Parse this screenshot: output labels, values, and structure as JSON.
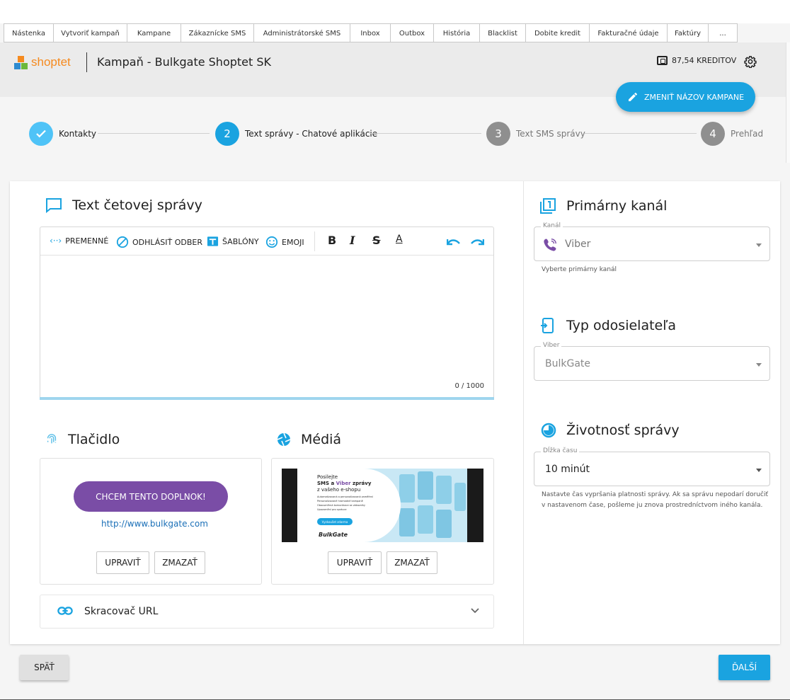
{
  "nav": {
    "tabs": [
      "Nástenka",
      "Vytvoriť kampaň",
      "Kampane",
      "Zákaznícke SMS",
      "Administrátorské SMS",
      "Inbox",
      "Outbox",
      "História",
      "Blacklist",
      "Dobite kredit",
      "Fakturačné údaje",
      "Faktúry",
      "..."
    ]
  },
  "header": {
    "brand": "shoptet",
    "title": "Kampaň - Bulkgate Shoptet SK",
    "credits": "87,54 KREDITOV",
    "rename_label": "ZMENIŤ NÁZOV KAMPANE"
  },
  "steps": [
    {
      "label": "Kontakty",
      "num": "",
      "state": "done"
    },
    {
      "label": "Text správy - Chatové aplikácie",
      "num": "2",
      "state": "active"
    },
    {
      "label": "Text SMS správy",
      "num": "3",
      "state": "todo"
    },
    {
      "label": "Prehľad",
      "num": "4",
      "state": "todo"
    }
  ],
  "chat": {
    "title": "Text četovej správy",
    "toolbar": {
      "variables": "PREMENNÉ",
      "unsubscribe": "ODHLÁSIŤ ODBER",
      "templates": "ŠABLÓNY",
      "emoji": "EMOJI"
    },
    "counter": "0 / 1000"
  },
  "button_section": {
    "title": "Tlačidlo",
    "button_text": "CHCEM TENTO DOPLNOK!",
    "url": "http://www.bulkgate.com",
    "edit": "UPRAVIŤ",
    "delete": "ZMAZAŤ"
  },
  "media_section": {
    "title": "Médiá",
    "edit": "UPRAVIŤ",
    "delete": "ZMAZAŤ",
    "banner": {
      "line1": "Posilejte",
      "line2a": "SMS a ",
      "line2b": "Viber",
      "line2c": " zprávy",
      "line3": "z vašeho e-shopu",
      "bullets": [
        "Automatizovaná a personalizovaná zaměření",
        "Personalizované hromadné kampaně",
        "Obousměrná komunikace se zákazníky",
        "Upozornění pro správce"
      ],
      "cta": "Vyzkoušet zdarma",
      "brand": "BulkGate"
    }
  },
  "url_shortener": {
    "label": "Skracovač URL"
  },
  "primary_channel": {
    "title": "Primárny kanál",
    "legend": "Kanál",
    "value": "Viber",
    "helper": "Vyberte primárny kanál"
  },
  "sender_type": {
    "title": "Typ odosielateľa",
    "legend": "Viber",
    "value": "BulkGate"
  },
  "lifetime": {
    "title": "Životnosť správy",
    "legend": "Dĺžka času",
    "value": "10 minút",
    "helper": "Nastavte čas vypršania platnosti správy. Ak sa správu nepodarí doručiť v nastavenom čase, pošleme ju znova prostredníctvom iného kanála."
  },
  "footer": {
    "back": "SPÄŤ",
    "next": "ĎALŠÍ"
  },
  "colors": {
    "accent": "#1aa3e0",
    "viber": "#7a4da6",
    "done_step": "#4fc3f7",
    "todo_step": "#8f8f8f",
    "shoptet_orange": "#f58a1f"
  }
}
